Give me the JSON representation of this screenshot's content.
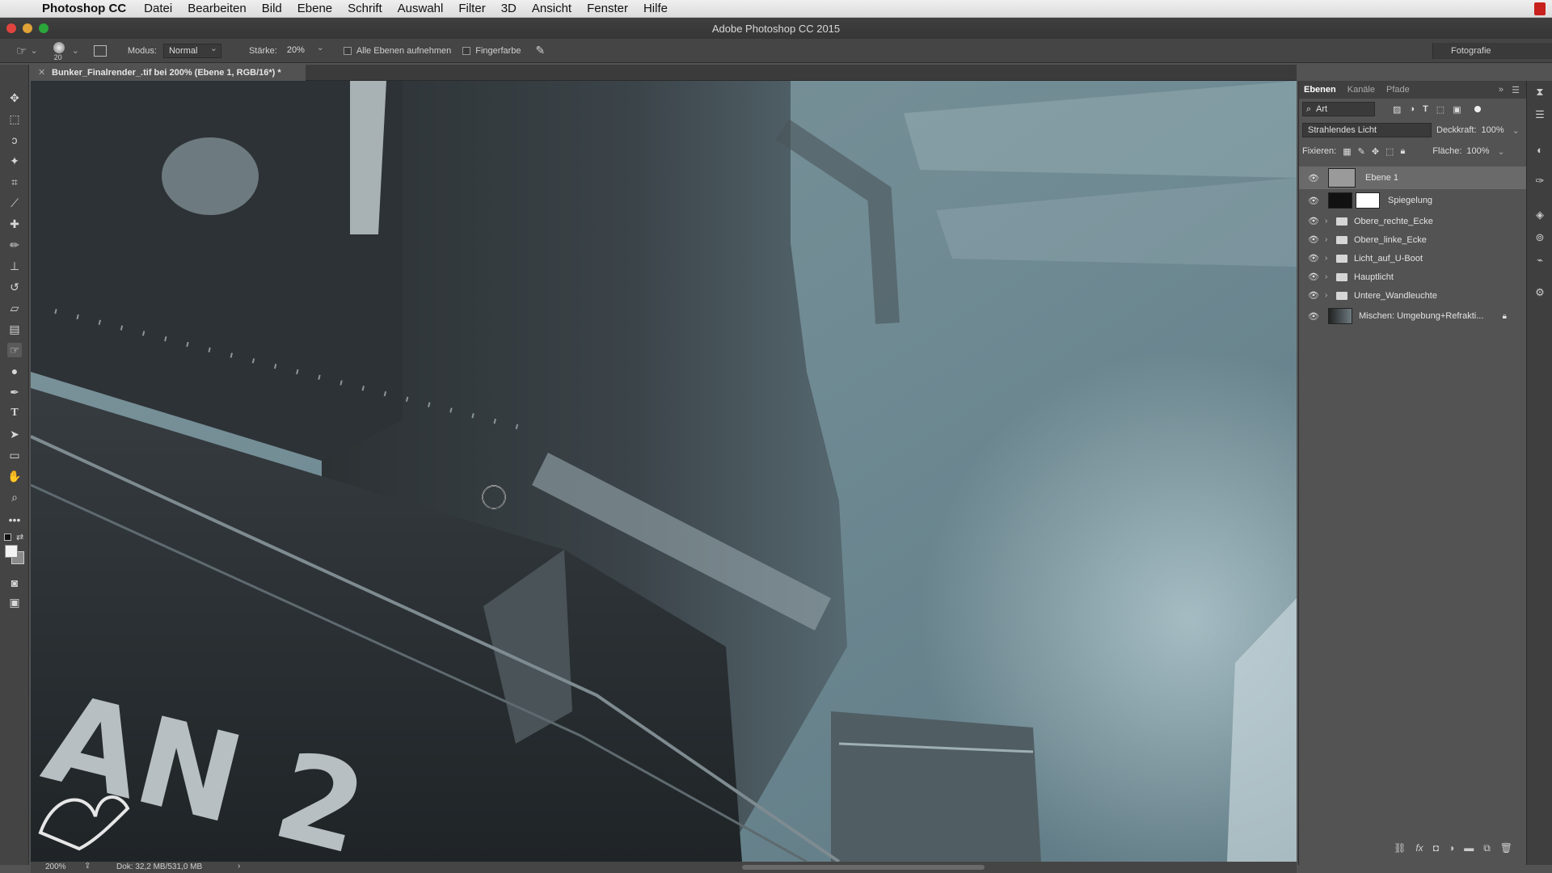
{
  "menubar": {
    "app": "Photoshop CC",
    "items": [
      "Datei",
      "Bearbeiten",
      "Bild",
      "Ebene",
      "Schrift",
      "Auswahl",
      "Filter",
      "3D",
      "Ansicht",
      "Fenster",
      "Hilfe"
    ]
  },
  "titlebar": {
    "title": "Adobe Photoshop CC 2015"
  },
  "options": {
    "brush_size": "20",
    "mode_label": "Modus:",
    "mode_value": "Normal",
    "strength_label": "Stärke:",
    "strength_value": "20%",
    "all_layers": "Alle Ebenen aufnehmen",
    "finger_paint": "Fingerfarbe",
    "workspace": "Fotografie"
  },
  "document": {
    "tab_title": "Bunker_Finalrender_.tif bei 200% (Ebene 1, RGB/16*) *",
    "zoom": "200%",
    "doc_info": "Dok: 32,2 MB/531,0 MB",
    "hull_text": "AN 2"
  },
  "panel": {
    "tabs": [
      "Ebenen",
      "Kanäle",
      "Pfade"
    ],
    "filter_value": "Art",
    "blend_mode": "Strahlendes Licht",
    "opacity_label": "Deckkraft:",
    "opacity_value": "100%",
    "lock_label": "Fixieren:",
    "fill_label": "Fläche:",
    "fill_value": "100%",
    "layers": [
      {
        "name": "Ebene 1",
        "type": "pixel",
        "selected": true
      },
      {
        "name": "Spiegelung",
        "type": "adjust",
        "selected": false
      },
      {
        "name": "Obere_rechte_Ecke",
        "type": "group",
        "selected": false
      },
      {
        "name": "Obere_linke_Ecke",
        "type": "group",
        "selected": false
      },
      {
        "name": "Licht_auf_U-Boot",
        "type": "group",
        "selected": false
      },
      {
        "name": "Hauptlicht",
        "type": "group",
        "selected": false
      },
      {
        "name": "Untere_Wandleuchte",
        "type": "group",
        "selected": false
      },
      {
        "name": "Mischen: Umgebung+Refrakti...",
        "type": "locked",
        "selected": false
      }
    ]
  },
  "colors": {
    "accent_red": "#c8201c",
    "panel_bg": "#535353",
    "canvas_sky": "#6e8a94"
  }
}
